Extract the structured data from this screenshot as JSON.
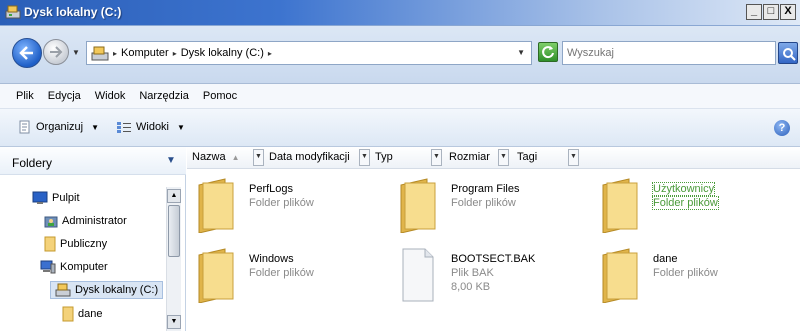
{
  "window": {
    "title": "Dysk lokalny (C:)",
    "controls": [
      "_",
      "□",
      "X"
    ]
  },
  "address": {
    "crumbs": [
      "Komputer",
      "Dysk lokalny (C:)"
    ],
    "search_placeholder": "Wyszukaj"
  },
  "menu": [
    "Plik",
    "Edycja",
    "Widok",
    "Narzędzia",
    "Pomoc"
  ],
  "toolbar": {
    "organize": "Organizuj",
    "views": "Widoki",
    "help": "?"
  },
  "nav": {
    "header": "Foldery",
    "items": [
      "Pulpit",
      "Administrator",
      "Publiczny",
      "Komputer",
      "Dysk lokalny (C:)",
      "dane"
    ]
  },
  "columns": [
    "Nazwa",
    "Data modyfikacji",
    "Typ",
    "Rozmiar",
    "Tagi"
  ],
  "files": [
    {
      "name": "PerfLogs",
      "type": "Folder plików",
      "size": ""
    },
    {
      "name": "Program Files",
      "type": "Folder plików",
      "size": ""
    },
    {
      "name": "Użytkownicy",
      "type": "Folder plików",
      "size": ""
    },
    {
      "name": "Windows",
      "type": "Folder plików",
      "size": ""
    },
    {
      "name": "BOOTSECT.BAK",
      "type": "Plik BAK",
      "size": "8,00 KB"
    },
    {
      "name": "dane",
      "type": "Folder plików",
      "size": ""
    }
  ]
}
